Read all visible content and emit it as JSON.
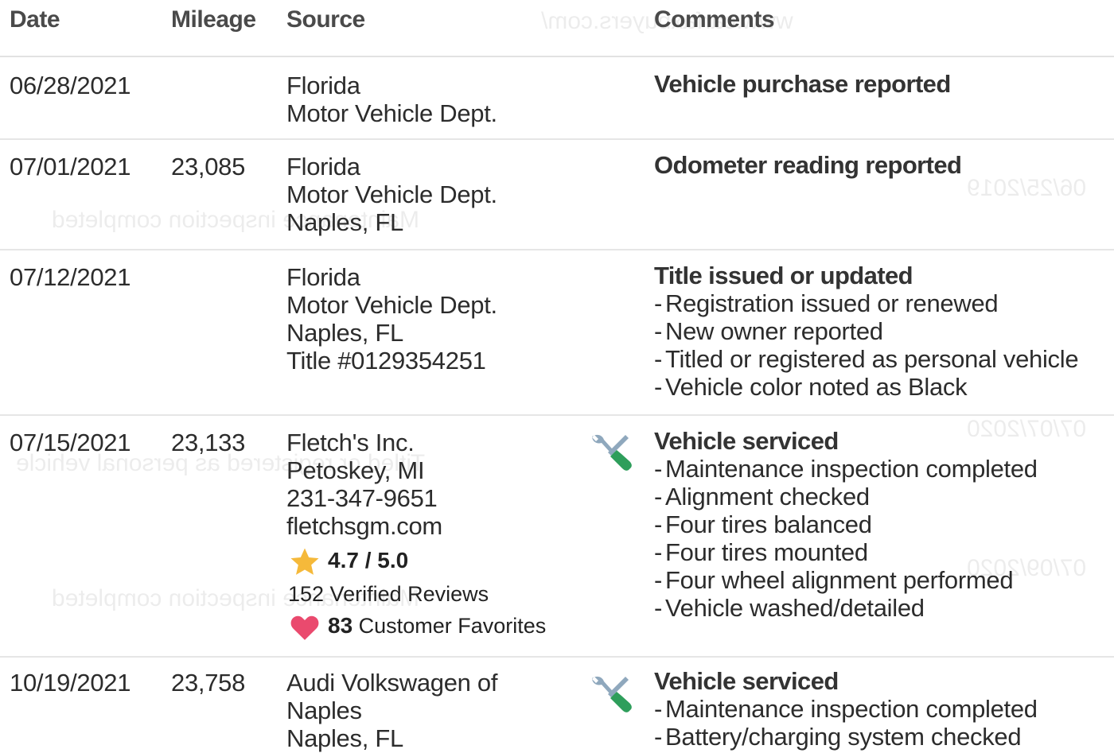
{
  "header": {
    "date": "Date",
    "mileage": "Mileage",
    "source": "Source",
    "comments": "Comments"
  },
  "rows": [
    {
      "date": "06/28/2021",
      "mileage": "",
      "source": [
        "Florida",
        "Motor Vehicle Dept."
      ],
      "title": "Vehicle purchase reported",
      "items": []
    },
    {
      "date": "07/01/2021",
      "mileage": "23,085",
      "source": [
        "Florida",
        "Motor Vehicle Dept.",
        "Naples, FL"
      ],
      "title": "Odometer reading reported",
      "items": []
    },
    {
      "date": "07/12/2021",
      "mileage": "",
      "source": [
        "Florida",
        "Motor Vehicle Dept.",
        "Naples, FL",
        "Title #0129354251"
      ],
      "title": "Title issued or updated",
      "items": [
        "Registration issued or renewed",
        "New owner reported",
        "Titled or registered as personal vehicle",
        "Vehicle color noted as Black"
      ]
    },
    {
      "date": "07/15/2021",
      "mileage": "23,133",
      "source": [
        "Fletch's Inc.",
        "Petoskey, MI",
        "231-347-9651",
        "fletchsgm.com"
      ],
      "rating": "4.7 / 5.0",
      "reviews": "152 Verified Reviews",
      "favorites_count": "83",
      "favorites_label": "Customer Favorites",
      "title": "Vehicle serviced",
      "icon": "service-tools-icon",
      "items": [
        "Maintenance inspection completed",
        "Alignment checked",
        "Four tires balanced",
        "Four tires mounted",
        "Four wheel alignment performed",
        "Vehicle washed/detailed"
      ]
    },
    {
      "date": "10/19/2021",
      "mileage": "23,758",
      "source": [
        "Audi Volkswagen of",
        "Naples",
        "Naples, FL"
      ],
      "title": "Vehicle serviced",
      "icon": "service-tools-icon",
      "items": [
        "Maintenance inspection completed",
        "Battery/charging system checked"
      ]
    }
  ],
  "colors": {
    "star": "#f5b93a",
    "heart": "#ea4a6e",
    "wrench": "#8fa8bd",
    "screwdriver_handle": "#2e9e5b"
  }
}
